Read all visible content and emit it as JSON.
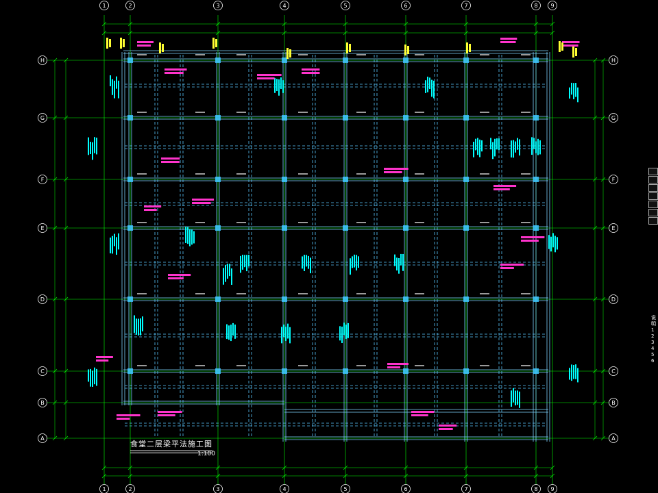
{
  "drawing": {
    "title": "食堂二层梁平法施工图",
    "scale": "1:100",
    "notes_label": "说明",
    "note_marks": [
      "1",
      "2",
      "3",
      "4",
      "5",
      "6"
    ]
  },
  "axes": {
    "columns": [
      "1",
      "2",
      "3",
      "4",
      "5",
      "6",
      "7",
      "8",
      "9"
    ],
    "rows": [
      "H",
      "G",
      "F",
      "E",
      "D",
      "C",
      "B",
      "A"
    ]
  },
  "colors": {
    "background": "#000000",
    "axis_line": "#00ff00",
    "beam_line": "#7fd4ff",
    "beam_dash": "#5ac8ff",
    "label_magenta": "#ff33cc",
    "label_yellow": "#ffff33",
    "label_cyan": "#00ffff",
    "column_fill": "#3cc8ff",
    "text_white": "#ffffff"
  }
}
